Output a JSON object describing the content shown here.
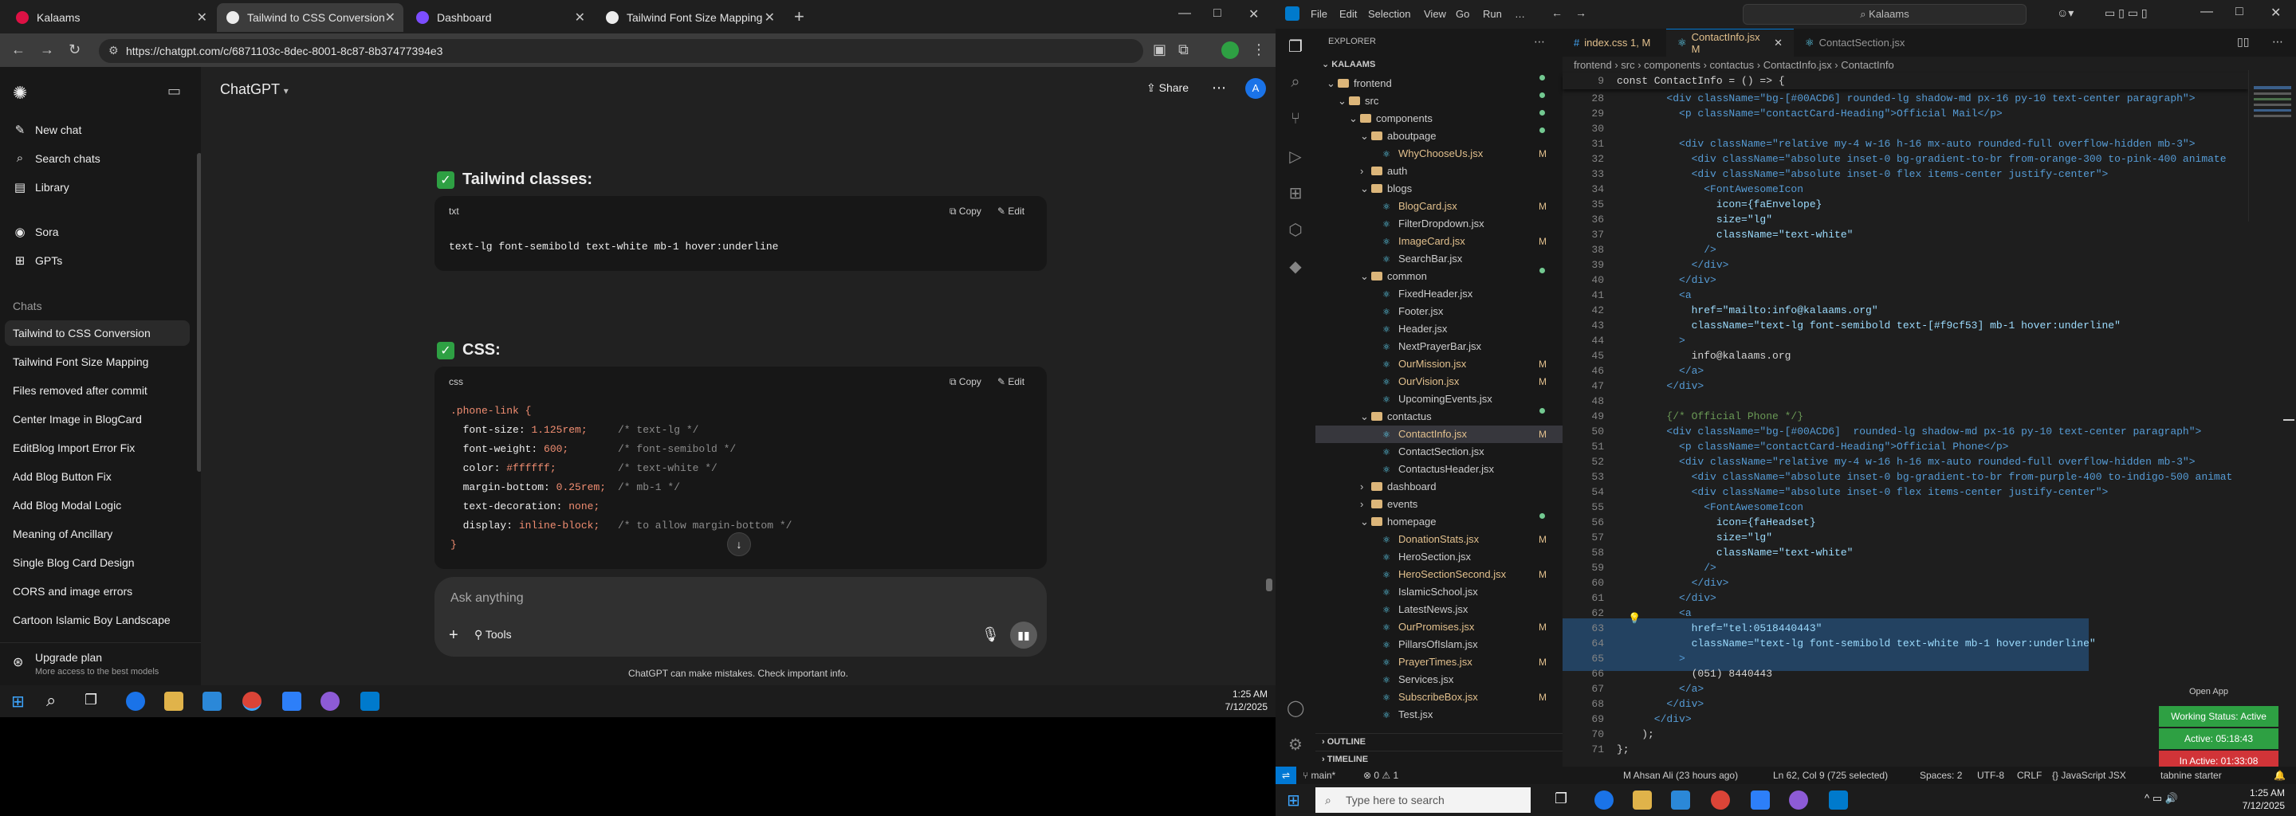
{
  "chrome": {
    "tabs": [
      {
        "title": "Kalaams",
        "color": "#d14"
      },
      {
        "title": "Tailwind to CSS Conversion",
        "color": "#ececec"
      },
      {
        "title": "Dashboard",
        "color": "#7c4dff"
      },
      {
        "title": "Tailwind Font Size Mapping",
        "color": "#ececec"
      }
    ],
    "url": "https://chatgpt.com/c/6871103c-8dec-8001-8c87-8b37477394e3",
    "window_controls": [
      "—",
      "□",
      "✕"
    ]
  },
  "chatgpt": {
    "brand": "ChatGPT",
    "sidebar_top": [
      {
        "label": "New chat",
        "icon": "✎"
      },
      {
        "label": "Search chats",
        "icon": "⌕"
      },
      {
        "label": "Library",
        "icon": "▤"
      },
      {
        "label": "Sora",
        "icon": "◉"
      },
      {
        "label": "GPTs",
        "icon": "⊞"
      }
    ],
    "chats_heading": "Chats",
    "chats": [
      "Tailwind to CSS Conversion",
      "Tailwind Font Size Mapping",
      "Files removed after commit",
      "Center Image in BlogCard",
      "EditBlog Import Error Fix",
      "Add Blog Button Fix",
      "Add Blog Modal Logic",
      "Meaning of Ancillary",
      "Single Blog Card Design",
      "CORS and image errors",
      "Cartoon Islamic Boy Landscape"
    ],
    "upgrade_title": "Upgrade plan",
    "upgrade_sub": "More access to the best models",
    "share": "Share",
    "avatar_letter": "A",
    "section1_title": "Tailwind classes:",
    "section1_lang": "txt",
    "section1_code": "text-lg font-semibold text-white mb-1 hover:underline",
    "copy": "Copy",
    "edit": "Edit",
    "section2_title": "CSS:",
    "section2_lang": "css",
    "css_lines": [
      {
        "sel": ".phone-link {",
        "prop": "",
        "val": "",
        "cm": ""
      },
      {
        "sel": "",
        "prop": "font-size: ",
        "val": "1.125rem;",
        "cm": "/* text-lg */"
      },
      {
        "sel": "",
        "prop": "font-weight: ",
        "val": "600;",
        "cm": "/* font-semibold */"
      },
      {
        "sel": "",
        "prop": "color: ",
        "val": "#ffffff;",
        "cm": "/* text-white */"
      },
      {
        "sel": "",
        "prop": "margin-bottom: ",
        "val": "0.25rem;",
        "cm": "/* mb-1 */"
      },
      {
        "sel": "",
        "prop": "text-decoration: ",
        "val": "none;",
        "cm": ""
      },
      {
        "sel": "",
        "prop": "display: ",
        "val": "inline-block;",
        "cm": "/* to allow margin-bottom */"
      },
      {
        "sel": "}",
        "prop": "",
        "val": "",
        "cm": ""
      }
    ],
    "ask_placeholder": "Ask anything",
    "tools": "Tools",
    "disclaimer": "ChatGPT can make mistakes. Check important info."
  },
  "taskbar_left": {
    "time": "1:25 AM",
    "date": "7/12/2025"
  },
  "vscode": {
    "menu": [
      "File",
      "Edit",
      "Selection",
      "View",
      "Go",
      "Run",
      "…"
    ],
    "search": "Kalaams",
    "explorer_title": "EXPLORER",
    "root": "KALAAMS",
    "tree": [
      {
        "label": "frontend",
        "type": "folder",
        "depth": 1,
        "open": true,
        "dot": true
      },
      {
        "label": "src",
        "type": "folder",
        "depth": 2,
        "open": true,
        "dot": true
      },
      {
        "label": "components",
        "type": "folder",
        "depth": 3,
        "open": true,
        "dot": true
      },
      {
        "label": "aboutpage",
        "type": "folder",
        "depth": 4,
        "open": true,
        "dot": true
      },
      {
        "label": "WhyChooseUs.jsx",
        "type": "file",
        "depth": 5,
        "mark": "M"
      },
      {
        "label": "auth",
        "type": "folder",
        "depth": 4,
        "open": false
      },
      {
        "label": "blogs",
        "type": "folder",
        "depth": 4,
        "open": true
      },
      {
        "label": "BlogCard.jsx",
        "type": "file",
        "depth": 5,
        "mark": "M"
      },
      {
        "label": "FilterDropdown.jsx",
        "type": "file",
        "depth": 5
      },
      {
        "label": "ImageCard.jsx",
        "type": "file",
        "depth": 5,
        "mark": "M"
      },
      {
        "label": "SearchBar.jsx",
        "type": "file",
        "depth": 5
      },
      {
        "label": "common",
        "type": "folder",
        "depth": 4,
        "open": true,
        "dot": true
      },
      {
        "label": "FixedHeader.jsx",
        "type": "file",
        "depth": 5
      },
      {
        "label": "Footer.jsx",
        "type": "file",
        "depth": 5
      },
      {
        "label": "Header.jsx",
        "type": "file",
        "depth": 5
      },
      {
        "label": "NextPrayerBar.jsx",
        "type": "file",
        "depth": 5
      },
      {
        "label": "OurMission.jsx",
        "type": "file",
        "depth": 5,
        "mark": "M"
      },
      {
        "label": "OurVision.jsx",
        "type": "file",
        "depth": 5,
        "mark": "M"
      },
      {
        "label": "UpcomingEvents.jsx",
        "type": "file",
        "depth": 5
      },
      {
        "label": "contactus",
        "type": "folder",
        "depth": 4,
        "open": true,
        "dot": true
      },
      {
        "label": "ContactInfo.jsx",
        "type": "file",
        "depth": 5,
        "mark": "M",
        "selected": true
      },
      {
        "label": "ContactSection.jsx",
        "type": "file",
        "depth": 5
      },
      {
        "label": "ContactusHeader.jsx",
        "type": "file",
        "depth": 5
      },
      {
        "label": "dashboard",
        "type": "folder",
        "depth": 4,
        "open": false
      },
      {
        "label": "events",
        "type": "folder",
        "depth": 4,
        "open": false
      },
      {
        "label": "homepage",
        "type": "folder",
        "depth": 4,
        "open": true,
        "dot": true
      },
      {
        "label": "DonationStats.jsx",
        "type": "file",
        "depth": 5,
        "mark": "M"
      },
      {
        "label": "HeroSection.jsx",
        "type": "file",
        "depth": 5
      },
      {
        "label": "HeroSectionSecond.jsx",
        "type": "file",
        "depth": 5,
        "mark": "M"
      },
      {
        "label": "IslamicSchool.jsx",
        "type": "file",
        "depth": 5
      },
      {
        "label": "LatestNews.jsx",
        "type": "file",
        "depth": 5
      },
      {
        "label": "OurPromises.jsx",
        "type": "file",
        "depth": 5,
        "mark": "M"
      },
      {
        "label": "PillarsOfIslam.jsx",
        "type": "file",
        "depth": 5
      },
      {
        "label": "PrayerTimes.jsx",
        "type": "file",
        "depth": 5,
        "mark": "M"
      },
      {
        "label": "Services.jsx",
        "type": "file",
        "depth": 5
      },
      {
        "label": "SubscribeBox.jsx",
        "type": "file",
        "depth": 5,
        "mark": "M"
      },
      {
        "label": "Test.jsx",
        "type": "file",
        "depth": 5
      }
    ],
    "outline": "OUTLINE",
    "timeline": "TIMELINE",
    "tabs": [
      {
        "label": "index.css 1, M",
        "active": false
      },
      {
        "label": "ContactInfo.jsx M",
        "active": true
      },
      {
        "label": "ContactSection.jsx",
        "active": false
      }
    ],
    "breadcrumb": "frontend › src › components › contactus › ContactInfo.jsx › ContactInfo",
    "sticky": "const ContactInfo = () => {",
    "lines": [
      {
        "n": "28",
        "t": "        <div className=\"bg-[#00ACD6] rounded-lg shadow-md px-16 py-10 text-center paragraph\">"
      },
      {
        "n": "29",
        "t": "          <p className=\"contactCard-Heading\">Official Mail</p>"
      },
      {
        "n": "30",
        "t": ""
      },
      {
        "n": "31",
        "t": "          <div className=\"relative my-4 w-16 h-16 mx-auto rounded-full overflow-hidden mb-3\">"
      },
      {
        "n": "32",
        "t": "            <div className=\"absolute inset-0 bg-gradient-to-br from-orange-300 to-pink-400 animate"
      },
      {
        "n": "33",
        "t": "            <div className=\"absolute inset-0 flex items-center justify-center\">"
      },
      {
        "n": "34",
        "t": "              <FontAwesomeIcon"
      },
      {
        "n": "35",
        "t": "                icon={faEnvelope}"
      },
      {
        "n": "36",
        "t": "                size=\"lg\""
      },
      {
        "n": "37",
        "t": "                className=\"text-white\""
      },
      {
        "n": "38",
        "t": "              />"
      },
      {
        "n": "39",
        "t": "            </div>"
      },
      {
        "n": "40",
        "t": "          </div>"
      },
      {
        "n": "41",
        "t": "          <a"
      },
      {
        "n": "42",
        "t": "            href=\"mailto:info@kalaams.org\""
      },
      {
        "n": "43",
        "t": "            className=\"text-lg font-semibold text-[#f9cf53] mb-1 hover:underline\""
      },
      {
        "n": "44",
        "t": "          >"
      },
      {
        "n": "45",
        "t": "            info@kalaams.org"
      },
      {
        "n": "46",
        "t": "          </a>"
      },
      {
        "n": "47",
        "t": "        </div>"
      },
      {
        "n": "48",
        "t": ""
      },
      {
        "n": "49",
        "t": "        {/* Official Phone */}"
      },
      {
        "n": "50",
        "t": "        <div className=\"bg-[#00ACD6]  rounded-lg shadow-md px-16 py-10 text-center paragraph\">"
      },
      {
        "n": "51",
        "t": "          <p className=\"contactCard-Heading\">Official Phone</p>"
      },
      {
        "n": "52",
        "t": "          <div className=\"relative my-4 w-16 h-16 mx-auto rounded-full overflow-hidden mb-3\">"
      },
      {
        "n": "53",
        "t": "            <div className=\"absolute inset-0 bg-gradient-to-br from-purple-400 to-indigo-500 animat"
      },
      {
        "n": "54",
        "t": "            <div className=\"absolute inset-0 flex items-center justify-center\">"
      },
      {
        "n": "55",
        "t": "              <FontAwesomeIcon"
      },
      {
        "n": "56",
        "t": "                icon={faHeadset}"
      },
      {
        "n": "57",
        "t": "                size=\"lg\""
      },
      {
        "n": "58",
        "t": "                className=\"text-white\""
      },
      {
        "n": "59",
        "t": "              />"
      },
      {
        "n": "60",
        "t": "            </div>"
      },
      {
        "n": "61",
        "t": "          </div>"
      },
      {
        "n": "62",
        "t": "          <a"
      },
      {
        "n": "63",
        "t": "            href=\"tel:0518440443\""
      },
      {
        "n": "64",
        "t": "            className=\"text-lg font-semibold text-white mb-1 hover:underline\""
      },
      {
        "n": "65",
        "t": "          >"
      },
      {
        "n": "66",
        "t": "            (051) 8440443"
      },
      {
        "n": "67",
        "t": "          </a>"
      },
      {
        "n": "68",
        "t": "        </div>"
      },
      {
        "n": "69",
        "t": "      </div>"
      },
      {
        "n": "70",
        "t": "    );"
      },
      {
        "n": "71",
        "t": "};"
      }
    ],
    "status": {
      "branch": "main*",
      "problems": "⊗ 0 ⚠ 1",
      "blame": "M Ahsan Ali (23 hours ago)",
      "position": "Ln 62, Col 9 (725 selected)",
      "spaces": "Spaces: 2",
      "encoding": "UTF-8",
      "eol": "CRLF",
      "lang": "{} JavaScript JSX",
      "ext": "tabnine starter"
    },
    "open_app": "Open App",
    "working_status": "Working Status: Active",
    "active_time": "Active: 05:18:43",
    "inactive_time": "In Active: 01:33:08"
  },
  "taskbar_right": {
    "search": "Type here to search",
    "time": "1:25 AM",
    "date": "7/12/2025"
  }
}
